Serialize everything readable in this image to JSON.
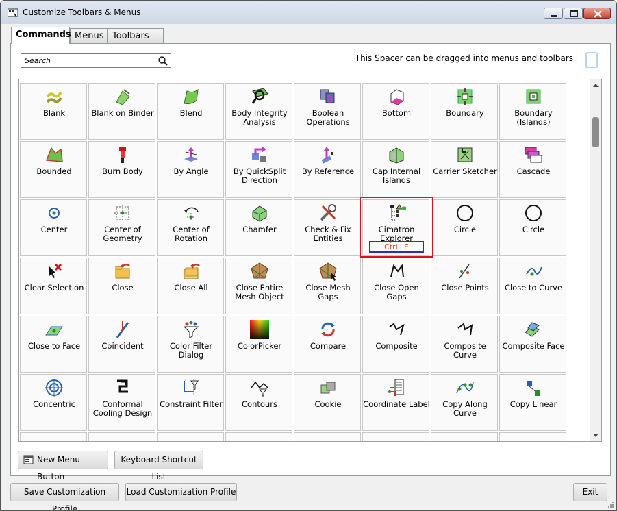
{
  "window": {
    "title": "Customize Toolbars & Menus"
  },
  "tabs": [
    {
      "label": "Commands",
      "active": true
    },
    {
      "label": "Menus",
      "active": false
    },
    {
      "label": "Toolbars",
      "active": false
    }
  ],
  "search": {
    "placeholder": "Search"
  },
  "spacer_hint": "This Spacer can be dragged into menus and toolbars",
  "commands": [
    {
      "label": "Blank",
      "icon": "blank-icon"
    },
    {
      "label": "Blank on Binder",
      "icon": "blank-on-binder-icon"
    },
    {
      "label": "Blend",
      "icon": "blend-icon"
    },
    {
      "label": "Body Integrity Analysis",
      "icon": "body-integrity-icon"
    },
    {
      "label": "Boolean Operations",
      "icon": "boolean-operations-icon"
    },
    {
      "label": "Bottom",
      "icon": "bottom-view-icon"
    },
    {
      "label": "Boundary",
      "icon": "boundary-icon"
    },
    {
      "label": "Boundary (Islands)",
      "icon": "boundary-islands-icon"
    },
    {
      "label": "Bounded",
      "icon": "bounded-icon"
    },
    {
      "label": "Burn Body",
      "icon": "burn-body-icon"
    },
    {
      "label": "By Angle",
      "icon": "by-angle-icon"
    },
    {
      "label": "By QuickSplit Direction",
      "icon": "quicksplit-direction-icon"
    },
    {
      "label": "By Reference",
      "icon": "by-reference-icon"
    },
    {
      "label": "Cap Internal Islands",
      "icon": "cap-islands-icon"
    },
    {
      "label": "Carrier Sketcher",
      "icon": "carrier-sketcher-icon"
    },
    {
      "label": "Cascade",
      "icon": "cascade-icon"
    },
    {
      "label": "Center",
      "icon": "center-icon"
    },
    {
      "label": "Center of Geometry",
      "icon": "center-of-geometry-icon"
    },
    {
      "label": "Center of Rotation",
      "icon": "center-of-rotation-icon"
    },
    {
      "label": "Chamfer",
      "icon": "chamfer-icon"
    },
    {
      "label": "Check & Fix Entities",
      "icon": "check-fix-icon"
    },
    {
      "label": "Cimatron Explorer",
      "icon": "cimatron-explorer-icon",
      "shortcut": "Ctrl+E",
      "highlighted": true
    },
    {
      "label": "Circle",
      "icon": "circle-icon"
    },
    {
      "label": "Circle",
      "icon": "circle-icon"
    },
    {
      "label": "Clear Selection",
      "icon": "clear-selection-icon"
    },
    {
      "label": "Close",
      "icon": "close-folder-icon"
    },
    {
      "label": "Close All",
      "icon": "close-all-icon"
    },
    {
      "label": "Close Entire Mesh Object",
      "icon": "close-mesh-object-icon"
    },
    {
      "label": "Close Mesh Gaps",
      "icon": "close-mesh-gaps-icon"
    },
    {
      "label": "Close Open Gaps",
      "icon": "close-open-gaps-icon"
    },
    {
      "label": "Close Points",
      "icon": "close-points-icon"
    },
    {
      "label": "Close to Curve",
      "icon": "close-to-curve-icon"
    },
    {
      "label": "Close to Face",
      "icon": "close-to-face-icon"
    },
    {
      "label": "Coincident",
      "icon": "coincident-icon"
    },
    {
      "label": "Color Filter Dialog",
      "icon": "color-filter-icon"
    },
    {
      "label": "ColorPicker",
      "icon": "color-picker-icon"
    },
    {
      "label": "Compare",
      "icon": "compare-icon"
    },
    {
      "label": "Composite",
      "icon": "composite-icon"
    },
    {
      "label": "Composite Curve",
      "icon": "composite-curve-icon"
    },
    {
      "label": "Composite Face",
      "icon": "composite-face-icon"
    },
    {
      "label": "Concentric",
      "icon": "concentric-icon"
    },
    {
      "label": "Conformal Cooling Design",
      "icon": "conformal-cooling-icon"
    },
    {
      "label": "Constraint Filter",
      "icon": "constraint-filter-icon"
    },
    {
      "label": "Contours",
      "icon": "contours-icon"
    },
    {
      "label": "Cookie",
      "icon": "cookie-icon"
    },
    {
      "label": "Coordinate Label",
      "icon": "coordinate-label-icon"
    },
    {
      "label": "Copy Along Curve",
      "icon": "copy-along-curve-icon"
    },
    {
      "label": "Copy Linear",
      "icon": "copy-linear-icon"
    },
    {
      "label": "",
      "icon": "points-icon"
    },
    {
      "label": "",
      "icon": "axis-icon"
    },
    {
      "label": "",
      "icon": "dots-icon"
    },
    {
      "label": "",
      "icon": "brush-icon"
    },
    {
      "label": "",
      "icon": "sphere-icon"
    },
    {
      "label": "",
      "icon": "arc-icon"
    },
    {
      "label": "",
      "icon": "diamond-icon"
    },
    {
      "label": "",
      "icon": "curve-icon"
    }
  ],
  "buttons": {
    "new_menu": "New Menu Button",
    "shortcuts": "Keyboard Shortcut List",
    "save_profile": "Save Customization Profile",
    "load_profile": "Load Customization Profile",
    "exit": "Exit"
  },
  "colors": {
    "highlight": "#e0101a",
    "shortcut_border": "#2233cc",
    "shortcut_text": "#e64a00"
  }
}
